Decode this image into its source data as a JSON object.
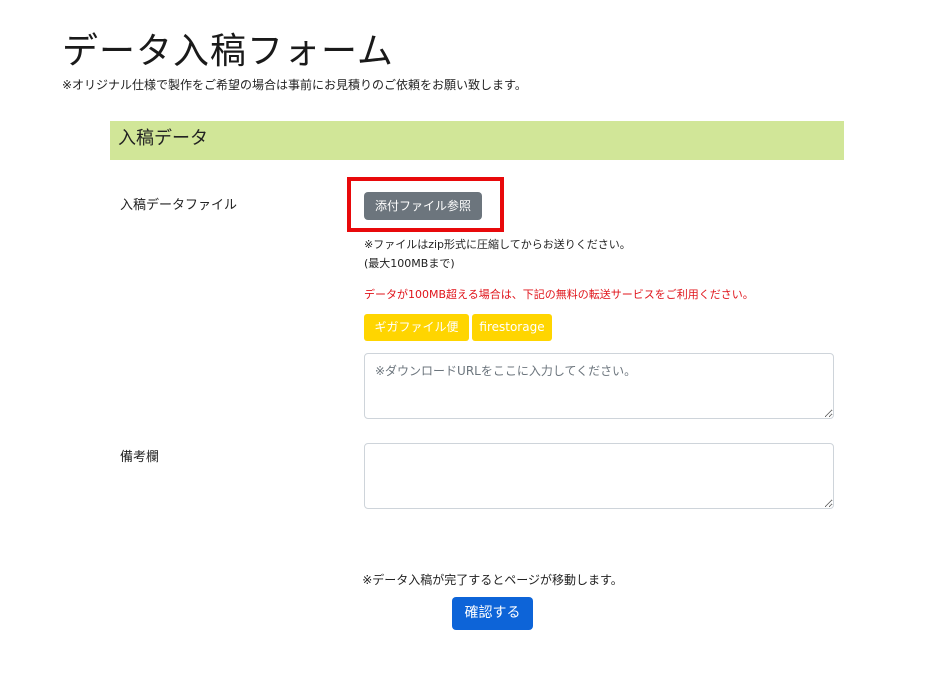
{
  "page": {
    "title": "データ入稿フォーム",
    "intro_note": "※オリジナル仕様で製作をご希望の場合は事前にお見積りのご依頼をお願い致します。"
  },
  "section": {
    "title": "入稿データ"
  },
  "file_row": {
    "label": "入稿データファイル",
    "browse_button": "添付ファイル参照",
    "note_zip": "※ファイルはzip形式に圧縮してからお送りください。",
    "note_max": "(最大100MBまで)",
    "note_transfer": "データが100MB超える場合は、下記の無料の転送サービスをご利用ください。",
    "services": [
      "ギガファイル便",
      "firestorage"
    ],
    "url_field": {
      "placeholder": "※ダウンロードURLをここに入力してください。",
      "value": ""
    }
  },
  "remarks_row": {
    "label": "備考欄",
    "value": ""
  },
  "submit": {
    "note": "※データ入稿が完了するとページが移動します。",
    "button": "確認する"
  },
  "colors": {
    "section_header_bg": "#d1e698",
    "browse_button_bg": "#6c757d",
    "service_button_bg": "#ffd500",
    "submit_button_bg": "#0d64d8",
    "highlight_border": "#e8090b",
    "warning_text": "#e0141b"
  }
}
